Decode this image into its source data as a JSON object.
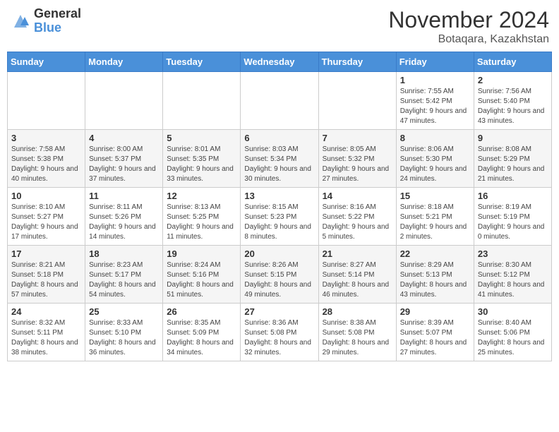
{
  "logo": {
    "general": "General",
    "blue": "Blue"
  },
  "title": "November 2024",
  "subtitle": "Botaqara, Kazakhstan",
  "weekdays": [
    "Sunday",
    "Monday",
    "Tuesday",
    "Wednesday",
    "Thursday",
    "Friday",
    "Saturday"
  ],
  "weeks": [
    [
      {
        "day": "",
        "info": ""
      },
      {
        "day": "",
        "info": ""
      },
      {
        "day": "",
        "info": ""
      },
      {
        "day": "",
        "info": ""
      },
      {
        "day": "",
        "info": ""
      },
      {
        "day": "1",
        "info": "Sunrise: 7:55 AM\nSunset: 5:42 PM\nDaylight: 9 hours and 47 minutes."
      },
      {
        "day": "2",
        "info": "Sunrise: 7:56 AM\nSunset: 5:40 PM\nDaylight: 9 hours and 43 minutes."
      }
    ],
    [
      {
        "day": "3",
        "info": "Sunrise: 7:58 AM\nSunset: 5:38 PM\nDaylight: 9 hours and 40 minutes."
      },
      {
        "day": "4",
        "info": "Sunrise: 8:00 AM\nSunset: 5:37 PM\nDaylight: 9 hours and 37 minutes."
      },
      {
        "day": "5",
        "info": "Sunrise: 8:01 AM\nSunset: 5:35 PM\nDaylight: 9 hours and 33 minutes."
      },
      {
        "day": "6",
        "info": "Sunrise: 8:03 AM\nSunset: 5:34 PM\nDaylight: 9 hours and 30 minutes."
      },
      {
        "day": "7",
        "info": "Sunrise: 8:05 AM\nSunset: 5:32 PM\nDaylight: 9 hours and 27 minutes."
      },
      {
        "day": "8",
        "info": "Sunrise: 8:06 AM\nSunset: 5:30 PM\nDaylight: 9 hours and 24 minutes."
      },
      {
        "day": "9",
        "info": "Sunrise: 8:08 AM\nSunset: 5:29 PM\nDaylight: 9 hours and 21 minutes."
      }
    ],
    [
      {
        "day": "10",
        "info": "Sunrise: 8:10 AM\nSunset: 5:27 PM\nDaylight: 9 hours and 17 minutes."
      },
      {
        "day": "11",
        "info": "Sunrise: 8:11 AM\nSunset: 5:26 PM\nDaylight: 9 hours and 14 minutes."
      },
      {
        "day": "12",
        "info": "Sunrise: 8:13 AM\nSunset: 5:25 PM\nDaylight: 9 hours and 11 minutes."
      },
      {
        "day": "13",
        "info": "Sunrise: 8:15 AM\nSunset: 5:23 PM\nDaylight: 9 hours and 8 minutes."
      },
      {
        "day": "14",
        "info": "Sunrise: 8:16 AM\nSunset: 5:22 PM\nDaylight: 9 hours and 5 minutes."
      },
      {
        "day": "15",
        "info": "Sunrise: 8:18 AM\nSunset: 5:21 PM\nDaylight: 9 hours and 2 minutes."
      },
      {
        "day": "16",
        "info": "Sunrise: 8:19 AM\nSunset: 5:19 PM\nDaylight: 9 hours and 0 minutes."
      }
    ],
    [
      {
        "day": "17",
        "info": "Sunrise: 8:21 AM\nSunset: 5:18 PM\nDaylight: 8 hours and 57 minutes."
      },
      {
        "day": "18",
        "info": "Sunrise: 8:23 AM\nSunset: 5:17 PM\nDaylight: 8 hours and 54 minutes."
      },
      {
        "day": "19",
        "info": "Sunrise: 8:24 AM\nSunset: 5:16 PM\nDaylight: 8 hours and 51 minutes."
      },
      {
        "day": "20",
        "info": "Sunrise: 8:26 AM\nSunset: 5:15 PM\nDaylight: 8 hours and 49 minutes."
      },
      {
        "day": "21",
        "info": "Sunrise: 8:27 AM\nSunset: 5:14 PM\nDaylight: 8 hours and 46 minutes."
      },
      {
        "day": "22",
        "info": "Sunrise: 8:29 AM\nSunset: 5:13 PM\nDaylight: 8 hours and 43 minutes."
      },
      {
        "day": "23",
        "info": "Sunrise: 8:30 AM\nSunset: 5:12 PM\nDaylight: 8 hours and 41 minutes."
      }
    ],
    [
      {
        "day": "24",
        "info": "Sunrise: 8:32 AM\nSunset: 5:11 PM\nDaylight: 8 hours and 38 minutes."
      },
      {
        "day": "25",
        "info": "Sunrise: 8:33 AM\nSunset: 5:10 PM\nDaylight: 8 hours and 36 minutes."
      },
      {
        "day": "26",
        "info": "Sunrise: 8:35 AM\nSunset: 5:09 PM\nDaylight: 8 hours and 34 minutes."
      },
      {
        "day": "27",
        "info": "Sunrise: 8:36 AM\nSunset: 5:08 PM\nDaylight: 8 hours and 32 minutes."
      },
      {
        "day": "28",
        "info": "Sunrise: 8:38 AM\nSunset: 5:08 PM\nDaylight: 8 hours and 29 minutes."
      },
      {
        "day": "29",
        "info": "Sunrise: 8:39 AM\nSunset: 5:07 PM\nDaylight: 8 hours and 27 minutes."
      },
      {
        "day": "30",
        "info": "Sunrise: 8:40 AM\nSunset: 5:06 PM\nDaylight: 8 hours and 25 minutes."
      }
    ]
  ]
}
